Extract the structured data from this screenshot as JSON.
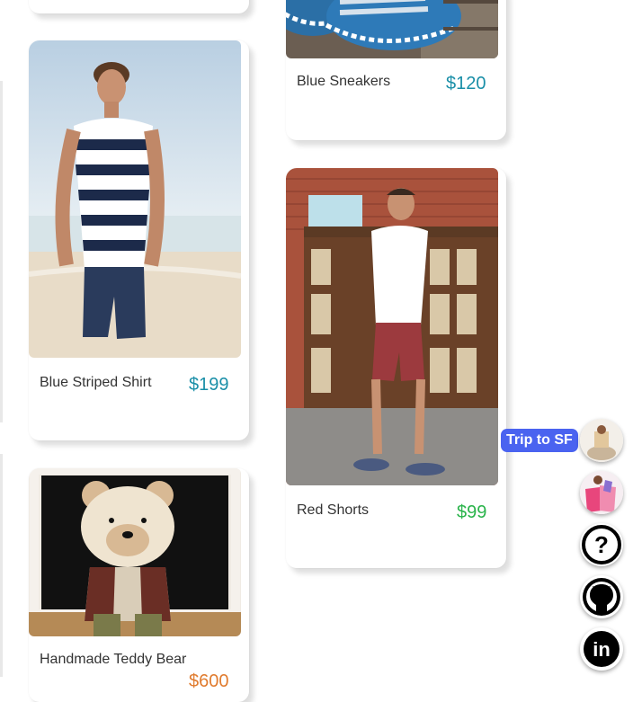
{
  "products": [
    {
      "title": "Blue Sneakers",
      "price": "$120"
    },
    {
      "title": "Blue Striped Shirt",
      "price": "$199"
    },
    {
      "title": "Red Shorts",
      "price": "$99"
    },
    {
      "title": "Handmade Teddy Bear",
      "price": "$600"
    }
  ],
  "sidebar": {
    "tooltip": "Trip to SF",
    "help_symbol": "?",
    "linkedin_text": "in"
  },
  "colors": {
    "price_teal": "#1a8fa8",
    "price_green": "#29b34a",
    "price_orange": "#e07b2e",
    "tooltip_bg": "#4a63f0"
  },
  "icons": [
    "trip-avatar-icon",
    "shopping-avatar-icon",
    "help-icon",
    "github-icon",
    "linkedin-icon"
  ]
}
